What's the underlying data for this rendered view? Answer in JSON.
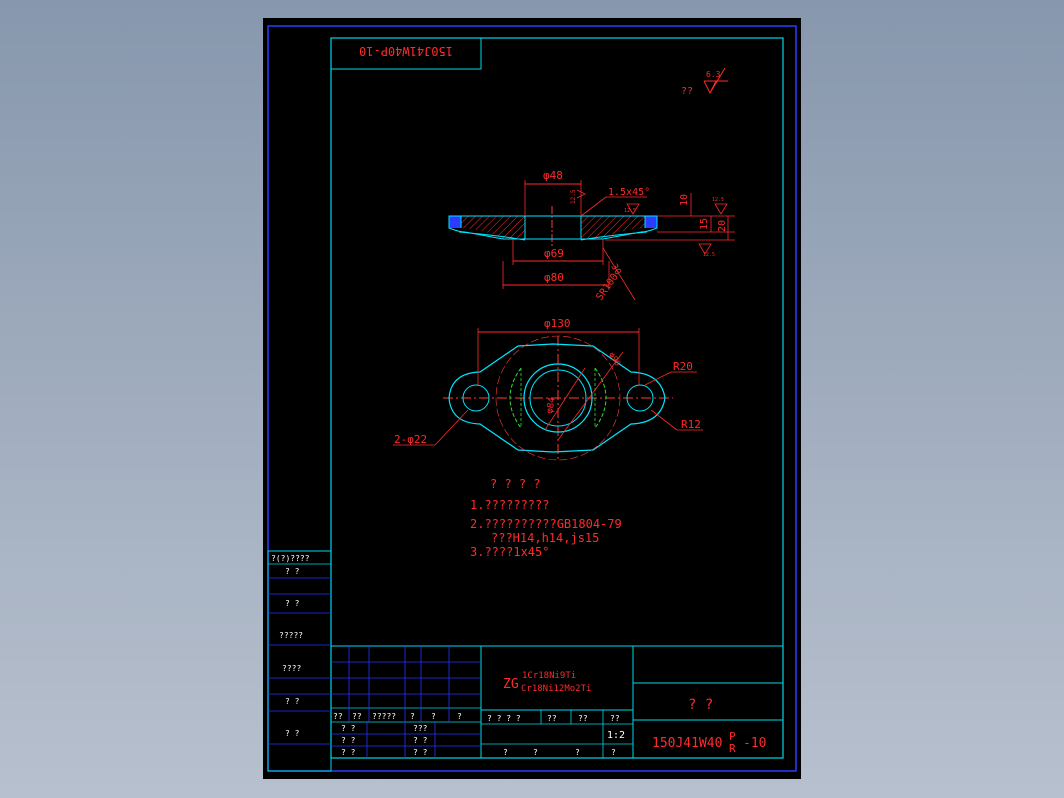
{
  "colors": {
    "background": "#8e9cb1",
    "sheet": "#000000",
    "outer_frame": "#2a3cff",
    "inner_frame": "#00d7e6",
    "dimension": "#ff2a2a",
    "part_outline": "#00e5ff",
    "hidden": "#33dd33",
    "centerline": "#ff3b3b",
    "title_block_grid": "#2233ff",
    "text": "#ff2a2a"
  },
  "drawing": {
    "code_box_rotated": "150J41W40P-10",
    "roughness_note_text": "??",
    "roughness_value": "6.3",
    "section_view": {
      "dim_d48": "φ48",
      "dim_chamfer": "1.5x45°",
      "dim_d69": "φ69",
      "dim_d80": "φ80",
      "dim_10": "10",
      "dim_15": "15",
      "dim_20": "20",
      "dim_sr100": "SR100",
      "dim_30": "30",
      "roughness_a": "12.5",
      "roughness_b": "12.5",
      "roughness_c": "12.5",
      "roughness_d": "12.5"
    },
    "plan_view": {
      "dim_d130": "φ130",
      "dim_d90": "φ90",
      "dim_d84": "φ84",
      "dim_r20": "R20",
      "dim_r12": "R12",
      "dim_holes": "2-φ22"
    },
    "notes": {
      "heading": "? ? ? ?",
      "line1": "1.?????????",
      "line2": "2.??????????GB1804-79",
      "line2b": "???H14,h14,js15",
      "line3": "3.????1x45°"
    }
  },
  "left_strip": {
    "header": "?(?)????",
    "rows": [
      "? ?",
      "? ?",
      "?????",
      "????",
      "? ?",
      "? ?"
    ]
  },
  "title_block": {
    "material_prefix": "ZG",
    "material_top": "1Cr18Ni9Ti",
    "material_bottom": "Cr18Ni12Mo2Ti",
    "part_name": "? ?",
    "drawing_number_main": "150J41W40",
    "drawing_number_p": "P",
    "drawing_number_r": "R",
    "drawing_number_suffix": "-10",
    "scale": "1:2",
    "hdr_row": [
      "??",
      "??",
      "?????",
      "?",
      "?",
      "?"
    ],
    "left_cells": [
      "? ?",
      "? ?",
      "? ?",
      "? ?"
    ],
    "mid_cells": [
      "???",
      "? ?",
      "? ?",
      "? ?"
    ],
    "top_mid": [
      "? ? ? ?",
      "??",
      "??",
      "??"
    ],
    "bottom_mid": [
      "?",
      "?",
      "?",
      "?"
    ]
  }
}
